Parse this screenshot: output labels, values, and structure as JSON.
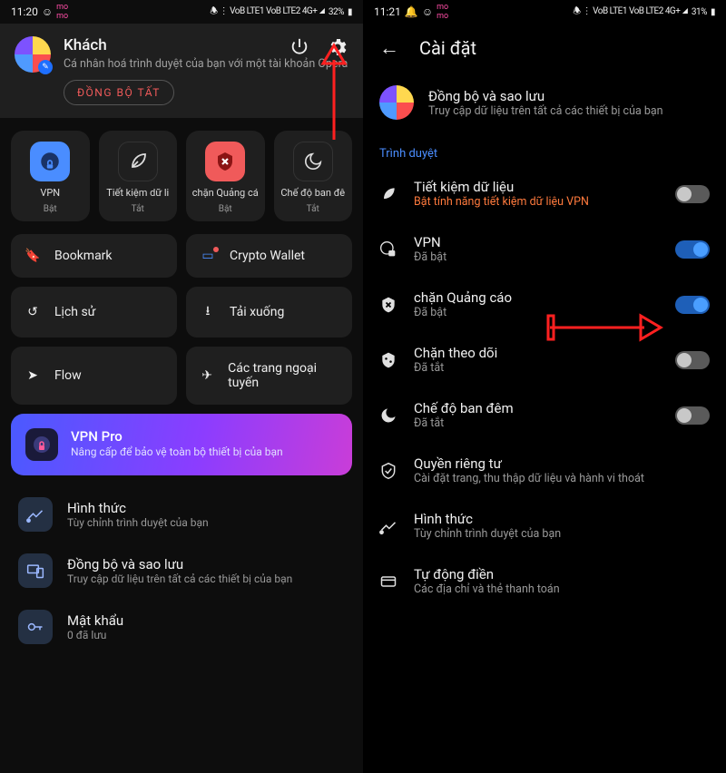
{
  "left": {
    "status": {
      "time": "11:20",
      "battery": "32%",
      "indicators": "🕭 ⋮ VoB LTE1 VoB LTE2 4G+ ◢"
    },
    "profile": {
      "title": "Khách",
      "subtitle": "Cá nhân hoá trình duyệt của bạn với một tài khoản Opera",
      "sync_btn": "ĐỒNG BỘ TẤT"
    },
    "tiles": [
      {
        "label": "VPN",
        "state": "Bật"
      },
      {
        "label": "Tiết kiệm dữ li",
        "state": "Tắt"
      },
      {
        "label": "chặn Quảng cá",
        "state": "Bật"
      },
      {
        "label": "Chế độ ban đê",
        "state": "Tắt"
      }
    ],
    "opts": {
      "bookmark": "Bookmark",
      "wallet": "Crypto Wallet",
      "history": "Lịch sử",
      "downloads": "Tải xuống",
      "flow": "Flow",
      "offline": "Các trang ngoại tuyến"
    },
    "promo": {
      "title": "VPN Pro",
      "subtitle": "Nâng cấp để bảo vệ toàn bộ thiết bị của bạn"
    },
    "list": [
      {
        "title": "Hình thức",
        "sub": "Tùy chỉnh trình duyệt của bạn"
      },
      {
        "title": "Đồng bộ và sao lưu",
        "sub": "Truy cập dữ liệu trên tất cả các thiết bị của bạn"
      },
      {
        "title": "Mật khẩu",
        "sub": "0 đã lưu"
      }
    ]
  },
  "right": {
    "status": {
      "time": "11:21",
      "battery": "31%",
      "indicators": "🕭 ⋮ VoB LTE1 VoB LTE2 4G+ ◢"
    },
    "header": "Cài đặt",
    "sync": {
      "title": "Đồng bộ và sao lưu",
      "sub": "Truy cập dữ liệu trên tất cả các thiết bị của bạn"
    },
    "section": "Trình duyệt",
    "rows": [
      {
        "title": "Tiết kiệm dữ liệu",
        "sub": "Bật tính năng tiết kiệm dữ liệu VPN",
        "warn": true,
        "toggle": false
      },
      {
        "title": "VPN",
        "sub": "Đã bật",
        "toggle": true
      },
      {
        "title": "chặn Quảng cáo",
        "sub": "Đã bật",
        "toggle": true
      },
      {
        "title": "Chặn theo dõi",
        "sub": "Đã tắt",
        "toggle": false
      },
      {
        "title": "Chế độ ban đêm",
        "sub": "Đã tắt",
        "toggle": false
      },
      {
        "title": "Quyền riêng tư",
        "sub": "Cài đặt trang, thu thập dữ liệu và hành vi thoát"
      },
      {
        "title": "Hình thức",
        "sub": "Tùy chỉnh trình duyệt của bạn"
      },
      {
        "title": "Tự động điền",
        "sub": "Các địa chỉ và thẻ thanh toán"
      }
    ]
  }
}
